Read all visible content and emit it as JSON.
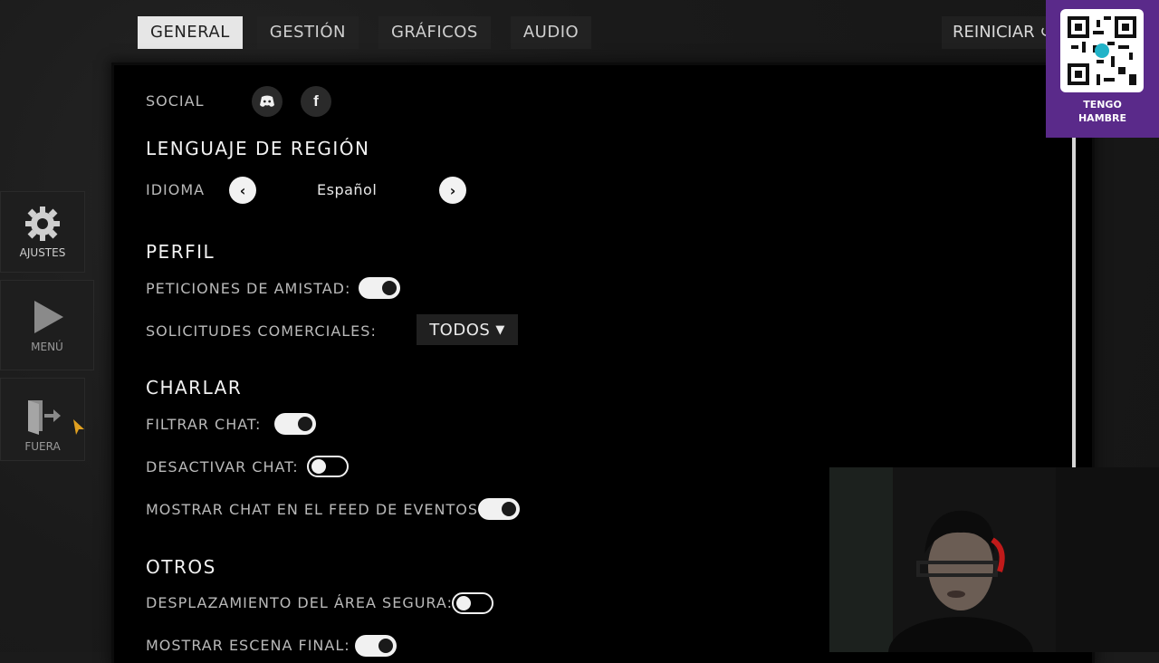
{
  "tabs": [
    {
      "label": "GENERAL",
      "active": true
    },
    {
      "label": "GESTIÓN",
      "active": false
    },
    {
      "label": "GRÁFICOS",
      "active": false
    },
    {
      "label": "AUDIO",
      "active": false
    }
  ],
  "reset_label": "REINICIAR",
  "sidebar": {
    "items": [
      {
        "label": "AJUSTES",
        "icon": "gear-icon"
      },
      {
        "label": "MENÚ",
        "icon": "play-icon"
      },
      {
        "label": "FUERA",
        "icon": "exit-door-icon"
      }
    ]
  },
  "social": {
    "label": "SOCIAL",
    "icons": [
      "discord-icon",
      "facebook-icon"
    ]
  },
  "region": {
    "title": "LENGUAJE DE REGIÓN",
    "language_label": "IDIOMA",
    "language_value": "Español"
  },
  "profile": {
    "title": "PERFIL",
    "friend_requests_label": "PETICIONES DE AMISTAD:",
    "friend_requests_on": true,
    "trade_requests_label": "SOLICITUDES COMERCIALES:",
    "trade_requests_value": "TODOS"
  },
  "chat": {
    "title": "CHARLAR",
    "filter_label": "FILTRAR CHAT:",
    "filter_on": true,
    "disable_label": "DESACTIVAR CHAT:",
    "disable_on": false,
    "feed_label": "MOSTRAR CHAT EN EL FEED DE EVENTOS:",
    "feed_on": true
  },
  "others": {
    "title": "OTROS",
    "safe_area_label": "DESPLAZAMIENTO DEL ÁREA SEGURA:",
    "safe_area_on": false,
    "end_scene_label": "MOSTRAR ESCENA FINAL:",
    "end_scene_on": true
  },
  "overlay": {
    "qr_caption_line1": "TENGO",
    "qr_caption_line2": "HAMBRE",
    "accent": "#5a2a8a"
  }
}
